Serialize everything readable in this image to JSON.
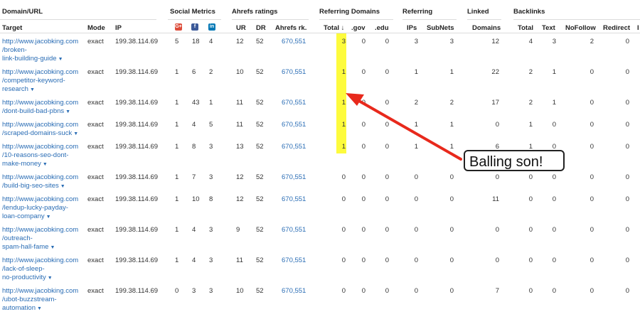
{
  "groups": {
    "domain_url": "Domain/URL",
    "social": "Social Metrics",
    "ahrefs": "Ahrefs ratings",
    "refdomains": "Referring Domains",
    "referring": "Referring",
    "linked": "Linked",
    "backlinks": "Backlinks"
  },
  "columns": {
    "target": "Target",
    "mode": "Mode",
    "ip": "IP",
    "ur": "UR",
    "dr": "DR",
    "ahrefs_rank": "Ahrefs rk.",
    "total": "Total ↓",
    "gov": ".gov",
    "edu": ".edu",
    "ips": "IPs",
    "subnets": "SubNets",
    "domains": "Domains",
    "bl_total": "Total",
    "text": "Text",
    "nofollow": "NoFollow",
    "redirect": "Redirect",
    "extra": "I"
  },
  "social_icons": [
    {
      "name": "google-plus-icon",
      "glyph": "G+",
      "color": "#dd4b39"
    },
    {
      "name": "facebook-icon",
      "glyph": "f",
      "color": "#3b5998"
    },
    {
      "name": "linkedin-icon",
      "glyph": "in",
      "color": "#0077b5"
    }
  ],
  "rows": [
    {
      "url": [
        "http://www.jacobking.com",
        "/broken-",
        "link-building-guide"
      ],
      "mode": "exact",
      "ip": "199.38.114.69",
      "g": "5",
      "f": "18",
      "li": "4",
      "ur": "12",
      "dr": "52",
      "rank": "670,551",
      "total": "3",
      "gov": "0",
      "edu": "0",
      "ips": "3",
      "subnets": "3",
      "domains": "12",
      "bl_total": "4",
      "text": "3",
      "nofollow": "2",
      "redirect": "0"
    },
    {
      "url": [
        "http://www.jacobking.com",
        "/competitor-keyword-",
        "research"
      ],
      "mode": "exact",
      "ip": "199.38.114.69",
      "g": "1",
      "f": "6",
      "li": "2",
      "ur": "10",
      "dr": "52",
      "rank": "670,551",
      "total": "1",
      "gov": "0",
      "edu": "0",
      "ips": "1",
      "subnets": "1",
      "domains": "22",
      "bl_total": "2",
      "text": "1",
      "nofollow": "0",
      "redirect": "0"
    },
    {
      "url": [
        "http://www.jacobking.com",
        "/dont-build-bad-pbns"
      ],
      "mode": "exact",
      "ip": "199.38.114.69",
      "g": "1",
      "f": "43",
      "li": "1",
      "ur": "11",
      "dr": "52",
      "rank": "670,551",
      "total": "1",
      "gov": "0",
      "edu": "0",
      "ips": "2",
      "subnets": "2",
      "domains": "17",
      "bl_total": "2",
      "text": "1",
      "nofollow": "0",
      "redirect": "0"
    },
    {
      "url": [
        "http://www.jacobking.com",
        "/scraped-domains-suck"
      ],
      "mode": "exact",
      "ip": "199.38.114.69",
      "g": "1",
      "f": "4",
      "li": "5",
      "ur": "11",
      "dr": "52",
      "rank": "670,551",
      "total": "1",
      "gov": "0",
      "edu": "0",
      "ips": "1",
      "subnets": "1",
      "domains": "0",
      "bl_total": "1",
      "text": "0",
      "nofollow": "0",
      "redirect": "0"
    },
    {
      "url": [
        "http://www.jacobking.com",
        "/10-reasons-seo-dont-",
        "make-money"
      ],
      "mode": "exact",
      "ip": "199.38.114.69",
      "g": "1",
      "f": "8",
      "li": "3",
      "ur": "13",
      "dr": "52",
      "rank": "670,551",
      "total": "1",
      "gov": "0",
      "edu": "0",
      "ips": "1",
      "subnets": "1",
      "domains": "6",
      "bl_total": "1",
      "text": "0",
      "nofollow": "0",
      "redirect": "0"
    },
    {
      "url": [
        "http://www.jacobking.com",
        "/build-big-seo-sites"
      ],
      "mode": "exact",
      "ip": "199.38.114.69",
      "g": "1",
      "f": "7",
      "li": "3",
      "ur": "12",
      "dr": "52",
      "rank": "670,551",
      "total": "0",
      "gov": "0",
      "edu": "0",
      "ips": "0",
      "subnets": "0",
      "domains": "0",
      "bl_total": "0",
      "text": "0",
      "nofollow": "0",
      "redirect": "0"
    },
    {
      "url": [
        "http://www.jacobking.com",
        "/lendup-lucky-payday-",
        "loan-company"
      ],
      "mode": "exact",
      "ip": "199.38.114.69",
      "g": "1",
      "f": "10",
      "li": "8",
      "ur": "12",
      "dr": "52",
      "rank": "670,551",
      "total": "0",
      "gov": "0",
      "edu": "0",
      "ips": "0",
      "subnets": "0",
      "domains": "11",
      "bl_total": "0",
      "text": "0",
      "nofollow": "0",
      "redirect": "0"
    },
    {
      "url": [
        "http://www.jacobking.com",
        "/outreach-",
        "spam-hall-fame"
      ],
      "mode": "exact",
      "ip": "199.38.114.69",
      "g": "1",
      "f": "4",
      "li": "3",
      "ur": "9",
      "dr": "52",
      "rank": "670,551",
      "total": "0",
      "gov": "0",
      "edu": "0",
      "ips": "0",
      "subnets": "0",
      "domains": "0",
      "bl_total": "0",
      "text": "0",
      "nofollow": "0",
      "redirect": "0"
    },
    {
      "url": [
        "http://www.jacobking.com",
        "/lack-of-sleep-",
        "no-productivity"
      ],
      "mode": "exact",
      "ip": "199.38.114.69",
      "g": "1",
      "f": "4",
      "li": "3",
      "ur": "11",
      "dr": "52",
      "rank": "670,551",
      "total": "0",
      "gov": "0",
      "edu": "0",
      "ips": "0",
      "subnets": "0",
      "domains": "0",
      "bl_total": "0",
      "text": "0",
      "nofollow": "0",
      "redirect": "0"
    },
    {
      "url": [
        "http://www.jacobking.com",
        "/ubot-buzzstream-",
        "automation"
      ],
      "mode": "exact",
      "ip": "199.38.114.69",
      "g": "0",
      "f": "3",
      "li": "3",
      "ur": "10",
      "dr": "52",
      "rank": "670,551",
      "total": "0",
      "gov": "0",
      "edu": "0",
      "ips": "0",
      "subnets": "0",
      "domains": "7",
      "bl_total": "0",
      "text": "0",
      "nofollow": "0",
      "redirect": "0"
    }
  ],
  "annotation": {
    "text": "Balling son!",
    "color": "#e8291c",
    "highlight": "#fdfb3d"
  }
}
